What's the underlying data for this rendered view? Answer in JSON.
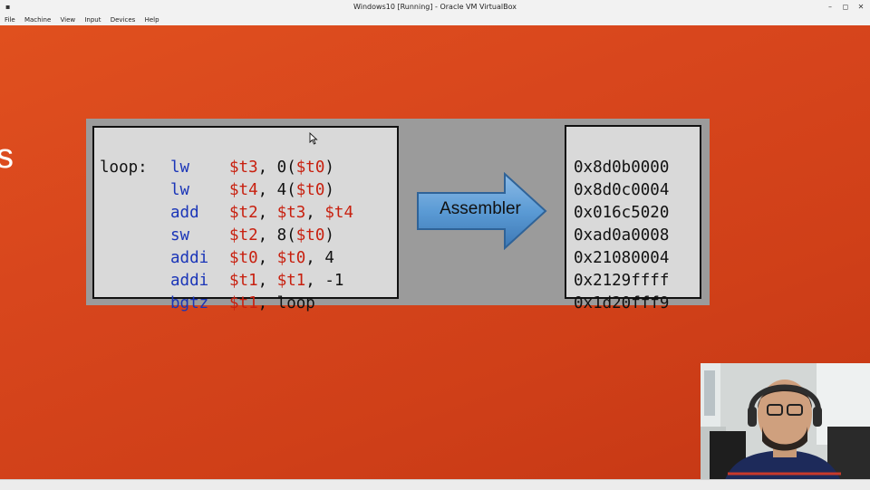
{
  "window": {
    "title": "Windows10 [Running] - Oracle VM VirtualBox",
    "app_icon": "virtualbox-icon",
    "controls": {
      "minimize": "–",
      "maximize": "◻",
      "close": "✕"
    }
  },
  "menu": [
    "File",
    "Machine",
    "View",
    "Input",
    "Devices",
    "Help"
  ],
  "slide": {
    "edge_text": "s",
    "assembly": [
      {
        "label": "loop:",
        "op": "lw",
        "args": [
          [
            "reg",
            "$t3"
          ],
          [
            "txt",
            ", 0("
          ],
          [
            "reg",
            "$t0"
          ],
          [
            "txt",
            ")"
          ]
        ]
      },
      {
        "label": "",
        "op": "lw",
        "args": [
          [
            "reg",
            "$t4"
          ],
          [
            "txt",
            ", 4("
          ],
          [
            "reg",
            "$t0"
          ],
          [
            "txt",
            ")"
          ]
        ]
      },
      {
        "label": "",
        "op": "add",
        "args": [
          [
            "reg",
            "$t2"
          ],
          [
            "txt",
            ", "
          ],
          [
            "reg",
            "$t3"
          ],
          [
            "txt",
            ", "
          ],
          [
            "reg",
            "$t4"
          ]
        ]
      },
      {
        "label": "",
        "op": "sw",
        "args": [
          [
            "reg",
            "$t2"
          ],
          [
            "txt",
            ", 8("
          ],
          [
            "reg",
            "$t0"
          ],
          [
            "txt",
            ")"
          ]
        ]
      },
      {
        "label": "",
        "op": "addi",
        "args": [
          [
            "reg",
            "$t0"
          ],
          [
            "txt",
            ", "
          ],
          [
            "reg",
            "$t0"
          ],
          [
            "txt",
            ", 4"
          ]
        ]
      },
      {
        "label": "",
        "op": "addi",
        "args": [
          [
            "reg",
            "$t1"
          ],
          [
            "txt",
            ", "
          ],
          [
            "reg",
            "$t1"
          ],
          [
            "txt",
            ", -1"
          ]
        ]
      },
      {
        "label": "",
        "op": "bgtz",
        "args": [
          [
            "reg",
            "$t1"
          ],
          [
            "txt",
            ", loop"
          ]
        ]
      }
    ],
    "arrow_label": "Assembler",
    "machine_code": [
      "0x8d0b0000",
      "0x8d0c0004",
      "0x016c5020",
      "0xad0a0008",
      "0x21080004",
      "0x2129ffff",
      "0x1d20fff9"
    ],
    "colors": {
      "background": "#d8461d",
      "opcode": "#1a35b8",
      "register": "#c8200f",
      "arrow": "#5b9bd5"
    }
  },
  "icons": {
    "cursor": "mouse-cursor-icon",
    "webcam": "webcam-presenter-image"
  }
}
